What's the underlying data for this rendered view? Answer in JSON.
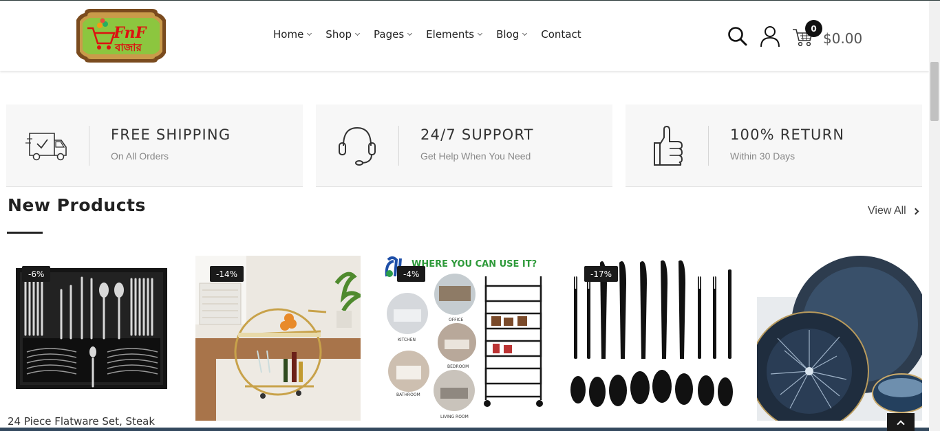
{
  "header": {
    "logo_text_latin": "FnF",
    "logo_text_bangla": "বাজার",
    "nav": [
      {
        "label": "Home",
        "has_dropdown": true
      },
      {
        "label": "Shop",
        "has_dropdown": true
      },
      {
        "label": "Pages",
        "has_dropdown": true
      },
      {
        "label": "Elements",
        "has_dropdown": true
      },
      {
        "label": "Blog",
        "has_dropdown": true
      },
      {
        "label": "Contact",
        "has_dropdown": false
      }
    ],
    "icons": [
      "search-icon",
      "user-icon",
      "cart-icon"
    ],
    "cart_count": "0",
    "cart_total": "$0.00"
  },
  "features": [
    {
      "icon": "delivery-truck-icon",
      "title": "FREE SHIPPING",
      "subtitle": "On All Orders"
    },
    {
      "icon": "headset-icon",
      "title": "24/7 SUPPORT",
      "subtitle": "Get Help When You Need"
    },
    {
      "icon": "thumbs-up-icon",
      "title": "100% RETURN",
      "subtitle": "Within 30 Days"
    }
  ],
  "new_products": {
    "title": "New Products",
    "view_all": "View All",
    "items": [
      {
        "badge": "-6%",
        "name": "24 Piece Flatware Set, Steak"
      },
      {
        "badge": "-14%"
      },
      {
        "badge": "-4%",
        "image_text": "WHERE YOU CAN USE IT?",
        "image_labels": [
          "OFFICE",
          "KITCHEN",
          "BEDROOM",
          "BATHROOM",
          "LIVING ROOM"
        ]
      },
      {
        "badge": "-17%"
      },
      {
        "badge": ""
      }
    ]
  },
  "colors": {
    "accent_dark": "#1a1a1a",
    "feature_bg": "#f7f7f7",
    "logo_green": "#8cc63f",
    "logo_frame": "#8b5a2b"
  }
}
